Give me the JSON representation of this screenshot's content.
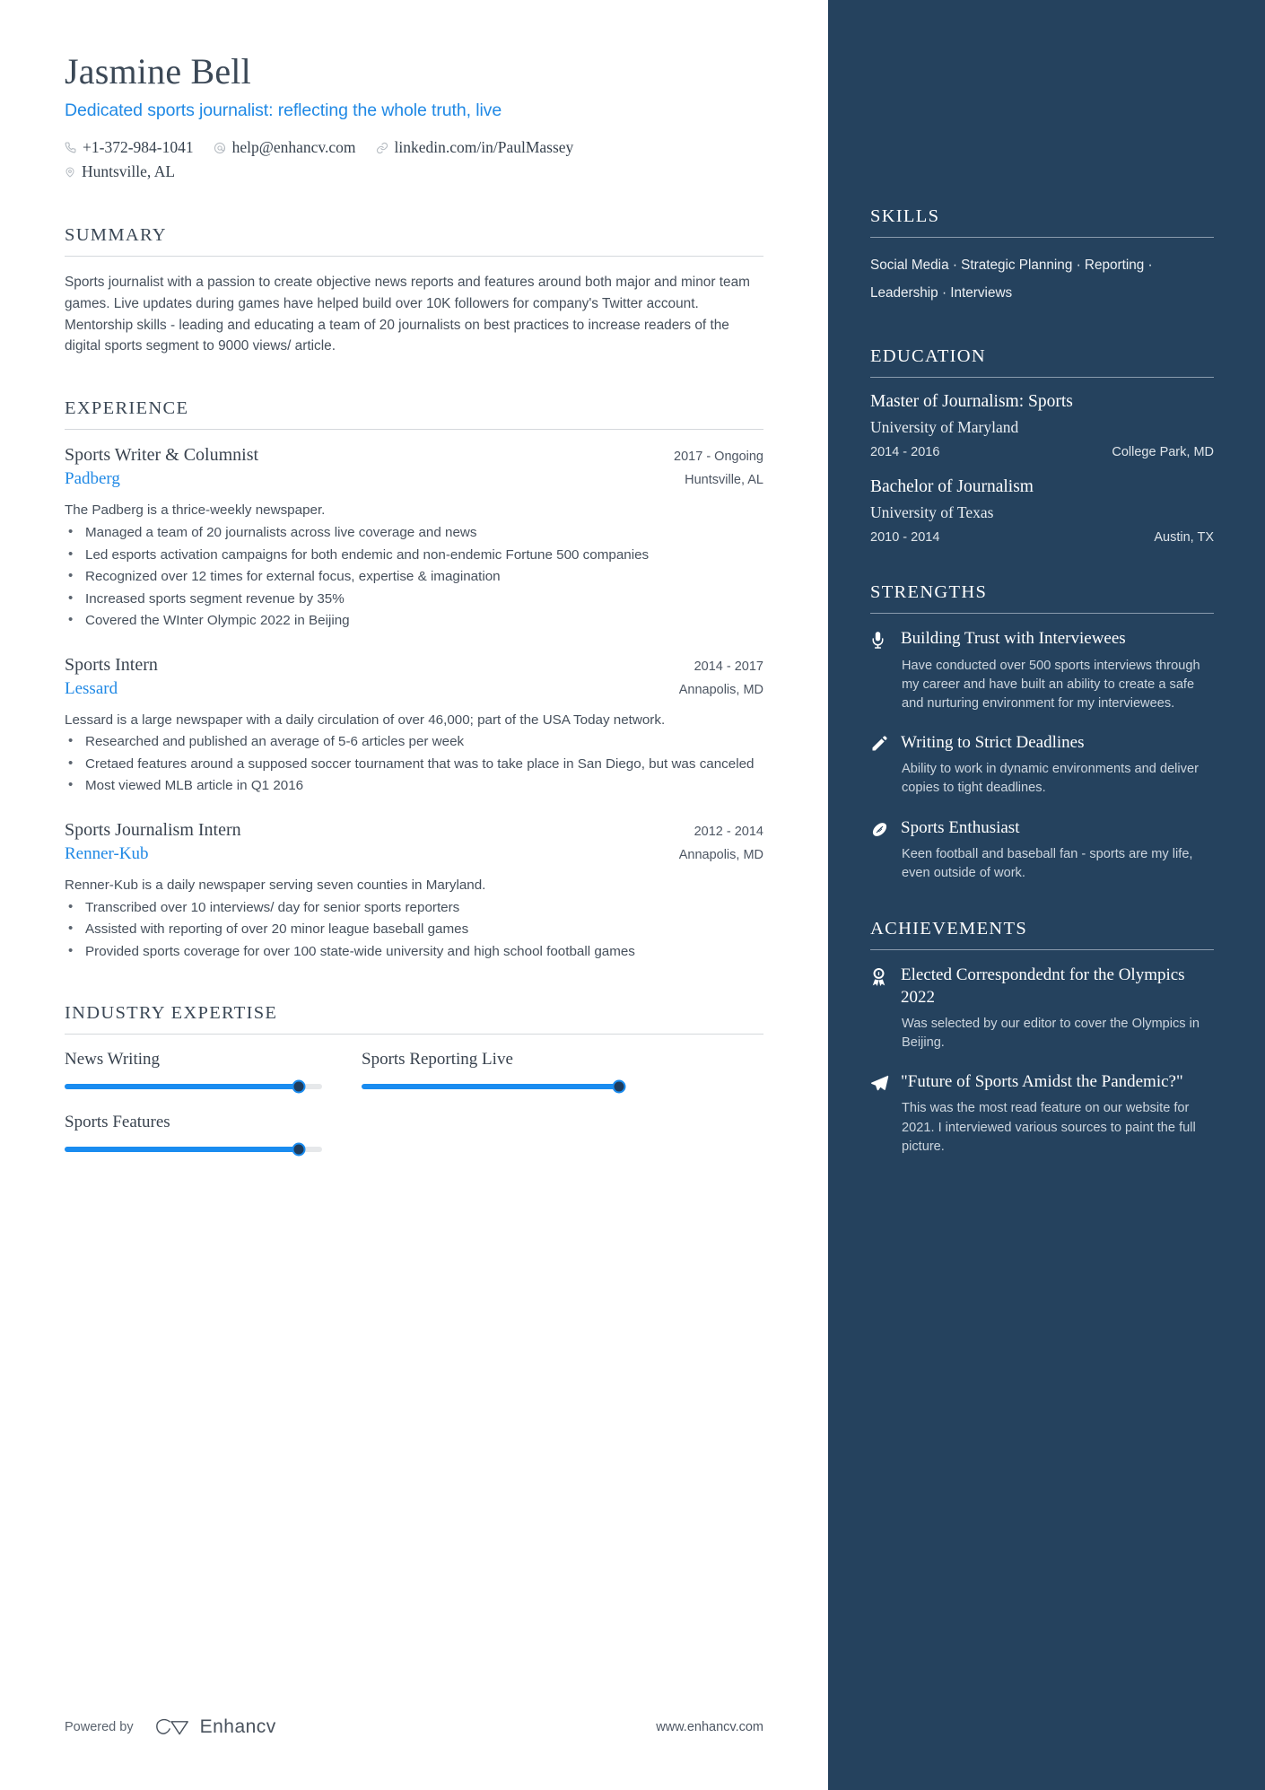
{
  "header": {
    "name": "Jasmine Bell",
    "tagline": "Dedicated sports journalist: reflecting the whole truth, live",
    "contacts": [
      {
        "icon": "phone-icon",
        "text": "+1-372-984-1041"
      },
      {
        "icon": "email-icon",
        "text": "help@enhancv.com"
      },
      {
        "icon": "link-icon",
        "text": "linkedin.com/in/PaulMassey"
      },
      {
        "icon": "location-pin-icon",
        "text": "Huntsville, AL"
      }
    ]
  },
  "summary": {
    "title": "SUMMARY",
    "text": "Sports journalist with a passion to create objective news reports and features around both major and minor team games. Live updates during games have helped build over 10K followers for company's Twitter account. Mentorship skills - leading and educating a team of 20 journalists on best practices to increase readers of the digital sports segment to 9000 views/ article."
  },
  "experience": {
    "title": "EXPERIENCE",
    "jobs": [
      {
        "title": "Sports Writer & Columnist",
        "dates": "2017 - Ongoing",
        "company": "Padberg",
        "location": "Huntsville, AL",
        "description": "The Padberg is a thrice-weekly newspaper.",
        "bullets": [
          "Managed a team of 20 journalists across live coverage and news",
          "Led esports activation campaigns for both endemic and non-endemic Fortune 500 companies",
          "Recognized over 12 times for external focus, expertise & imagination",
          "Increased sports segment revenue by 35%",
          "Covered the WInter Olympic 2022 in Beijing"
        ]
      },
      {
        "title": "Sports Intern",
        "dates": "2014 - 2017",
        "company": "Lessard",
        "location": "Annapolis, MD",
        "description": "Lessard is a large newspaper with a daily circulation of over 46,000; part of the USA Today network.",
        "bullets": [
          "Researched and published an average of 5-6 articles per week",
          "Cretaed features around a supposed soccer tournament that was to take place in San Diego, but was canceled",
          "Most viewed MLB article in Q1 2016"
        ]
      },
      {
        "title": "Sports Journalism Intern",
        "dates": "2012 - 2014",
        "company": "Renner-Kub",
        "location": "Annapolis, MD",
        "description": "Renner-Kub is a daily newspaper serving seven counties in Maryland.",
        "bullets": [
          "Transcribed over 10 interviews/ day for senior sports reporters",
          "Assisted with reporting of over 20 minor league baseball games",
          "Provided sports coverage for over 100 state-wide university and high school football games"
        ]
      }
    ]
  },
  "industry_expertise": {
    "title": "INDUSTRY EXPERTISE",
    "items": [
      {
        "label": "News Writing",
        "value": 91
      },
      {
        "label": "Sports Reporting Live",
        "value": 100
      },
      {
        "label": "Sports Features",
        "value": 91
      }
    ]
  },
  "footer": {
    "powered_by": "Powered by",
    "brand": "Enhancv",
    "website": "www.enhancv.com"
  },
  "sidebar": {
    "skills": {
      "title": "SKILLS",
      "text": "Social Media · Strategic Planning · Reporting  · Leadership · Interviews"
    },
    "education": {
      "title": "EDUCATION",
      "items": [
        {
          "degree": "Master of Journalism: Sports",
          "school": "University of Maryland",
          "dates": "2014 - 2016",
          "location": "College Park, MD"
        },
        {
          "degree": "Bachelor of Journalism",
          "school": "University of Texas",
          "dates": "2010 - 2014",
          "location": "Austin, TX"
        }
      ]
    },
    "strengths": {
      "title": "STRENGTHS",
      "items": [
        {
          "icon": "microphone-icon",
          "title": "Building Trust with Interviewees",
          "description": "Have conducted over 500 sports interviews through my career and have built an ability to create a safe and nurturing environment for my interviewees."
        },
        {
          "icon": "pencil-icon",
          "title": "Writing to Strict Deadlines",
          "description": "Ability to work in dynamic environments and deliver copies to tight deadlines."
        },
        {
          "icon": "football-icon",
          "title": "Sports Enthusiast",
          "description": "Keen football and baseball fan - sports are my life, even outside of work."
        }
      ]
    },
    "achievements": {
      "title": "ACHIEVEMENTS",
      "items": [
        {
          "icon": "award-ribbon-icon",
          "title": "Elected Correspondednt for the Olympics 2022",
          "description": "Was selected by our editor to cover the Olympics in Beijing."
        },
        {
          "icon": "paper-plane-icon",
          "title": "\"Future of Sports Amidst the Pandemic?\"",
          "description": "This was the most read feature on our website for 2021. I interviewed various sources to paint the full picture."
        }
      ]
    }
  },
  "colors": {
    "accent_blue": "#2089e5",
    "sidebar_bg": "#25425e",
    "slider_fill": "#1a8cf0",
    "slider_knob": "#1f3c5c",
    "heading": "#3b4856"
  }
}
